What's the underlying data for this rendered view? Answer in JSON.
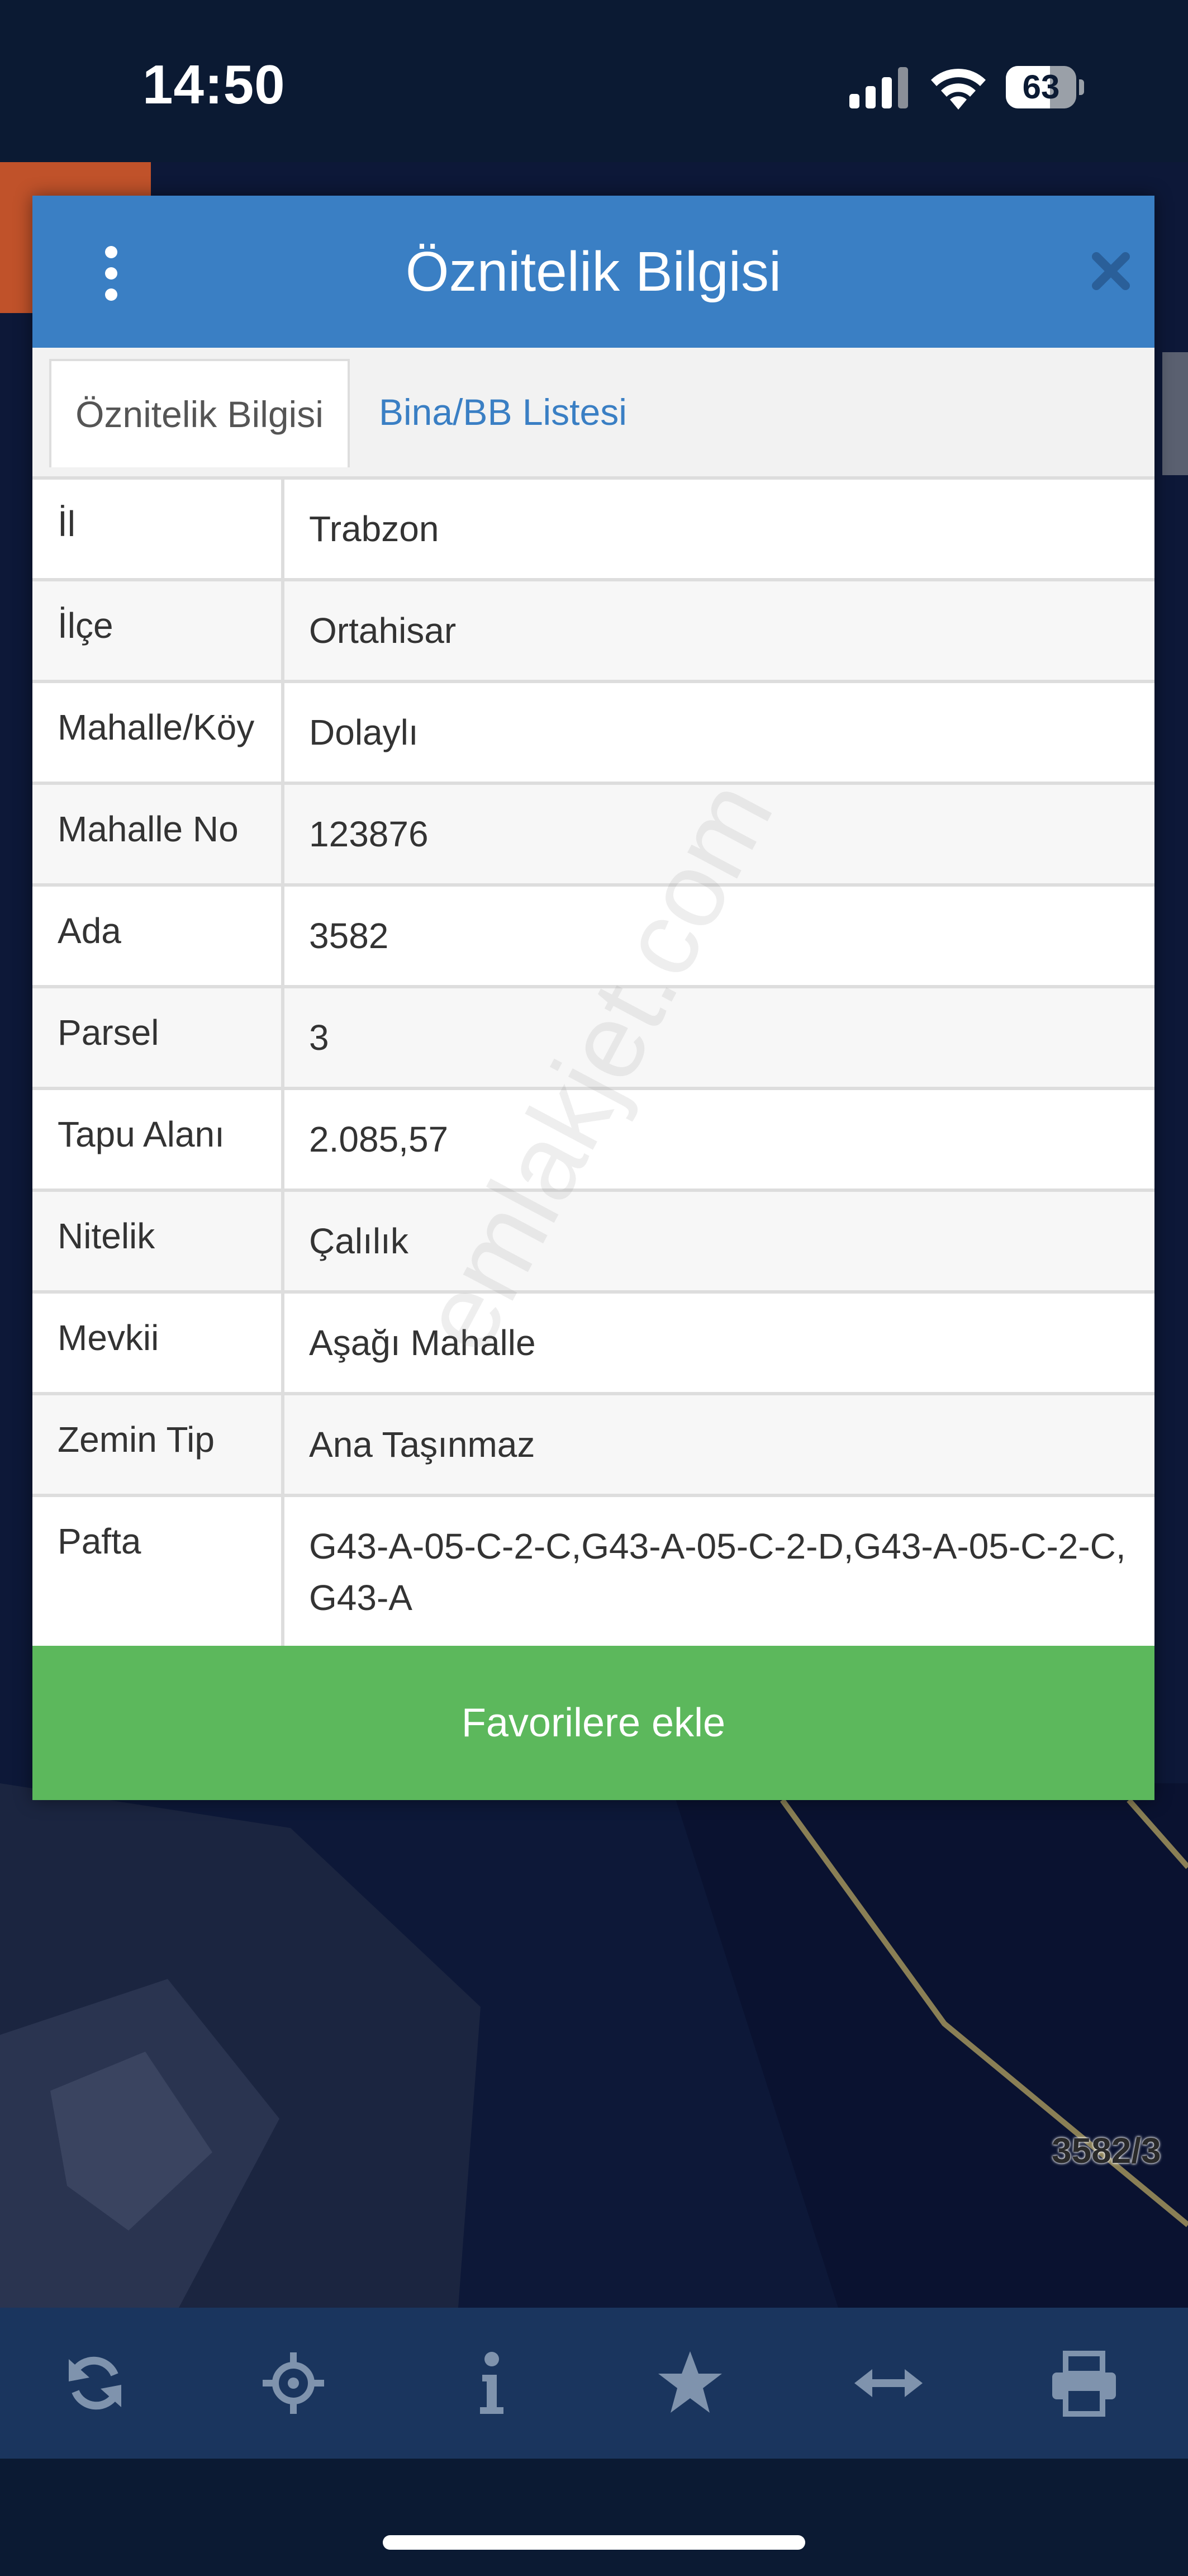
{
  "status_bar": {
    "time": "14:50",
    "battery_level": "63",
    "battery_fraction": 0.63
  },
  "modal": {
    "title": "Öznitelik Bilgisi",
    "tabs": [
      "Öznitelik Bilgisi",
      "Bina/BB Listesi"
    ],
    "active_tab": 0,
    "rows": [
      {
        "key": "İl",
        "value": "Trabzon"
      },
      {
        "key": "İlçe",
        "value": "Ortahisar"
      },
      {
        "key": "Mahalle/Köy",
        "value": "Dolaylı"
      },
      {
        "key": "Mahalle No",
        "value": "123876"
      },
      {
        "key": "Ada",
        "value": "3582"
      },
      {
        "key": "Parsel",
        "value": "3"
      },
      {
        "key": "Tapu Alanı",
        "value": "2.085,57"
      },
      {
        "key": "Nitelik",
        "value": "Çalılık"
      },
      {
        "key": "Mevkii",
        "value": "Aşağı Mahalle"
      },
      {
        "key": "Zemin Tip",
        "value": "Ana Taşınmaz"
      },
      {
        "key": "Pafta",
        "value": "G43-A-05-C-2-C,G43-A-05-C-2-D,G43-A-05-C-2-C,G43-A"
      }
    ],
    "favorite_button": "Favorilere ekle"
  },
  "watermark": "emlakjet.com",
  "map": {
    "parcel_label": "3582/3"
  },
  "toolbar": {
    "items": [
      "refresh-icon",
      "locate-icon",
      "info-icon",
      "star-icon",
      "measure-icon",
      "print-icon"
    ]
  },
  "colors": {
    "header": "#3a7fc4",
    "favorite_button": "#5cb85c",
    "toolbar": "#1a355e",
    "toolbar_icon": "#7f93ad",
    "status_bar": "#0b1a33"
  }
}
